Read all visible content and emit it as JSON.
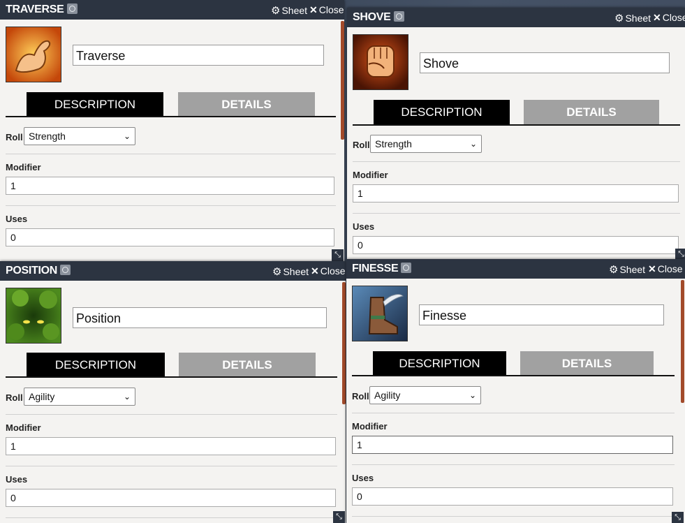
{
  "windows": [
    {
      "title": "TRAVERSE",
      "sheet_label": "Sheet",
      "close_label": "Close",
      "name": "Traverse",
      "tab_description": "DESCRIPTION",
      "tab_details": "DETAILS",
      "roll_label": "Roll",
      "roll_value": "Strength",
      "modifier_label": "Modifier",
      "modifier_value": "1",
      "uses_label": "Uses",
      "uses_value": "0",
      "avatar_icon": "flexed-arm-icon"
    },
    {
      "title": "SHOVE",
      "sheet_label": "Sheet",
      "close_label": "Close",
      "name": "Shove",
      "tab_description": "DESCRIPTION",
      "tab_details": "DETAILS",
      "roll_label": "Roll",
      "roll_value": "Strength",
      "modifier_label": "Modifier",
      "modifier_value": "1",
      "uses_label": "Uses",
      "uses_value": "0",
      "avatar_icon": "fist-icon"
    },
    {
      "title": "POSITION",
      "sheet_label": "Sheet",
      "close_label": "Close",
      "name": "Position",
      "tab_description": "DESCRIPTION",
      "tab_details": "DETAILS",
      "roll_label": "Roll",
      "roll_value": "Agility",
      "modifier_label": "Modifier",
      "modifier_value": "1",
      "uses_label": "Uses",
      "uses_value": "0",
      "avatar_icon": "glowing-eyes-in-bush-icon"
    },
    {
      "title": "FINESSE",
      "sheet_label": "Sheet",
      "close_label": "Close",
      "name": "Finesse",
      "tab_description": "DESCRIPTION",
      "tab_details": "DETAILS",
      "roll_label": "Roll",
      "roll_value": "Agility",
      "modifier_label": "Modifier",
      "modifier_value": "1",
      "uses_label": "Uses",
      "uses_value": "0",
      "avatar_icon": "winged-boot-icon"
    }
  ],
  "colors": {
    "titlebar": "#2c3441",
    "tab_active": "#000000",
    "tab_inactive": "#a1a1a1",
    "panel": "#f4f3f1"
  }
}
